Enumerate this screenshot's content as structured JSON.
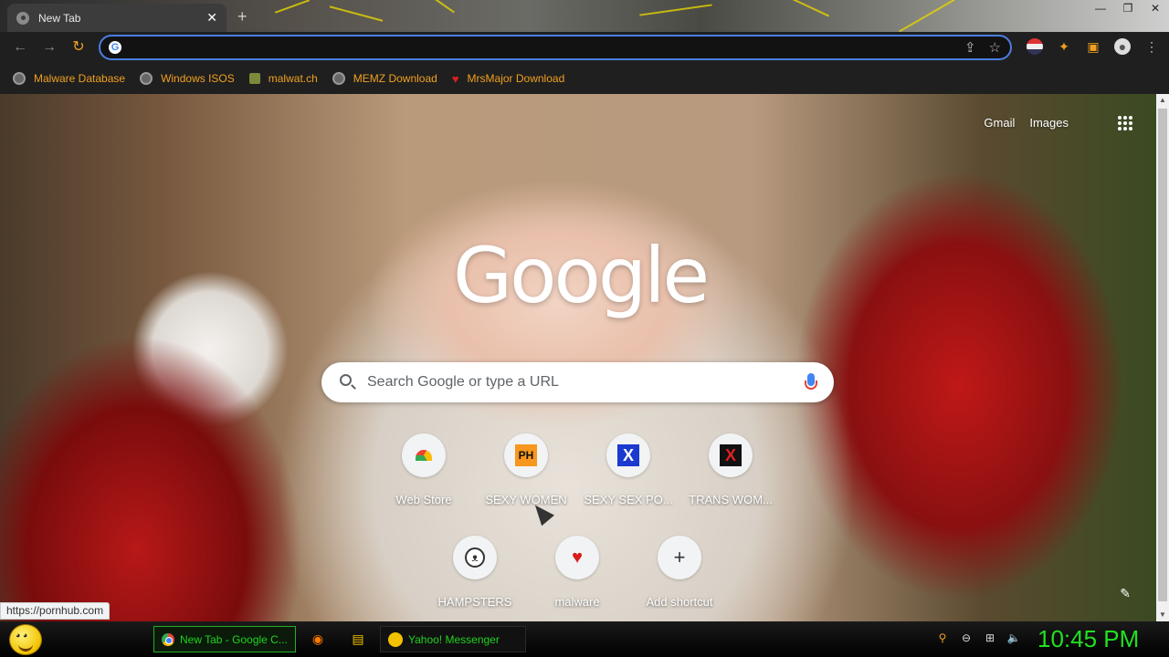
{
  "browser": {
    "tab_title": "New Tab",
    "tab_close": "✕",
    "new_tab": "+",
    "window_controls": [
      "—",
      "❐",
      "✕"
    ],
    "omnibox": {
      "value": "",
      "placeholder": ""
    },
    "bookmarks": [
      {
        "label": "Malware Database",
        "icon": "globe-icon"
      },
      {
        "label": "Windows ISOS",
        "icon": "globe-icon"
      },
      {
        "label": "malwat.ch",
        "icon": "person-icon"
      },
      {
        "label": "MEMZ Download",
        "icon": "globe-icon"
      },
      {
        "label": "MrsMajor Download",
        "icon": "heart-icon"
      }
    ]
  },
  "ntp": {
    "top_links": {
      "gmail": "Gmail",
      "images": "Images"
    },
    "logo": "Google",
    "search_placeholder": "Search Google or type a URL",
    "shortcuts": [
      {
        "label": "Web Store",
        "icon": "chrome-web-store-icon"
      },
      {
        "label": "SEXY WOMEN",
        "icon": "ph-icon",
        "icon_text": "PH"
      },
      {
        "label": "SEXY SEX PO...",
        "icon": "blue-x-icon",
        "icon_text": "X"
      },
      {
        "label": "TRANS WOM...",
        "icon": "red-x-icon",
        "icon_text": "X"
      },
      {
        "label": "HAMPSTERS",
        "icon": "hamster-icon"
      },
      {
        "label": "malware",
        "icon": "heart-icon",
        "icon_text": "♥"
      },
      {
        "label": "Add shortcut",
        "icon": "plus-icon",
        "icon_text": "+"
      }
    ],
    "status_url": "https://pornhub.com"
  },
  "taskbar": {
    "buttons": [
      {
        "label": "New Tab - Google C...",
        "active": true
      },
      {
        "label": "Yahoo! Messenger",
        "active": false
      }
    ],
    "clock": "10:45 PM"
  },
  "colors": {
    "bookmark_text": "#f0a020",
    "taskbar_text": "#1fd41f",
    "omnibox_focus": "#4a7ee0"
  }
}
